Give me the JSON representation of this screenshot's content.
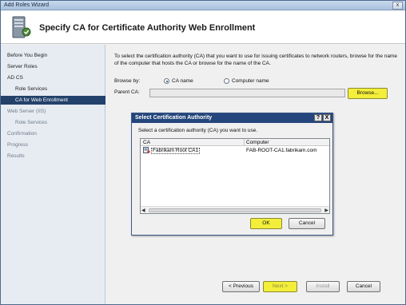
{
  "window": {
    "title": "Add Roles Wizard",
    "close_label": "x"
  },
  "header": {
    "title": "Specify CA for Certificate Authority Web Enrollment"
  },
  "nav": {
    "items": [
      {
        "label": "Before You Begin",
        "state": "normal"
      },
      {
        "label": "Server Roles",
        "state": "normal"
      },
      {
        "label": "AD CS",
        "state": "normal"
      },
      {
        "label": "Role Services",
        "state": "sub"
      },
      {
        "label": "CA for Web Enrollment",
        "state": "active"
      },
      {
        "label": "Web Server (IIS)",
        "state": "dim"
      },
      {
        "label": "Role Services",
        "state": "dim-sub"
      },
      {
        "label": "Confirmation",
        "state": "dim"
      },
      {
        "label": "Progress",
        "state": "dim"
      },
      {
        "label": "Results",
        "state": "dim"
      }
    ]
  },
  "content": {
    "description": "To select the certification authority (CA) that you want to use for issuing certificates to network routers, browse for the name of the computer that hosts the CA or browse for the name of the CA.",
    "browse_by_label": "Browse by:",
    "radio_ca_name": "CA name",
    "radio_computer_name": "Computer name",
    "selected_radio": "ca_name",
    "parent_ca_label": "Parent CA:",
    "parent_ca_value": "",
    "browse_button": "Browse..."
  },
  "dialog": {
    "title": "Select Certification Authority",
    "help_label": "?",
    "close_label": "X",
    "prompt": "Select a certification authority (CA) you want to use.",
    "columns": [
      "CA",
      "Computer"
    ],
    "rows": [
      {
        "ca": "Fabrikam Root CA1",
        "computer": "FAB-ROOT-CA1.fabrikam.com"
      }
    ],
    "ok_button": "OK",
    "cancel_button": "Cancel"
  },
  "footer": {
    "previous_button": "< Previous",
    "next_button": "Next >",
    "install_button": "Install",
    "cancel_button": "Cancel"
  },
  "colors": {
    "highlight": "#f3ee3a",
    "nav_active": "#23426b",
    "dialog_title": "#24467c"
  }
}
